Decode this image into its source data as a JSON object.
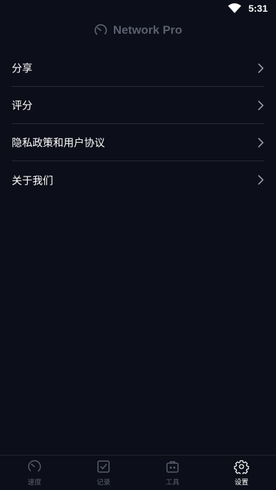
{
  "status_bar": {
    "time": "5:31",
    "wifi_icon": "wifi-icon"
  },
  "header": {
    "title": "Network Pro",
    "logo_icon": "speedometer-icon"
  },
  "settings": {
    "items": [
      {
        "label": "分享",
        "icon": "chevron-right-icon"
      },
      {
        "label": "评分",
        "icon": "chevron-right-icon"
      },
      {
        "label": "隐私政策和用户协议",
        "icon": "chevron-right-icon"
      },
      {
        "label": "关于我们",
        "icon": "chevron-right-icon"
      }
    ]
  },
  "bottom_nav": {
    "active_tab": "设置",
    "tabs": [
      {
        "label": "速度",
        "icon": "speedometer-icon"
      },
      {
        "label": "记录",
        "icon": "checkbox-icon"
      },
      {
        "label": "工具",
        "icon": "toolbox-icon"
      },
      {
        "label": "设置",
        "icon": "gear-icon"
      }
    ]
  },
  "colors": {
    "background": "#0c0e19",
    "divider": "#2a2d3a",
    "muted": "#5b5f6e",
    "text": "#ffffff"
  }
}
